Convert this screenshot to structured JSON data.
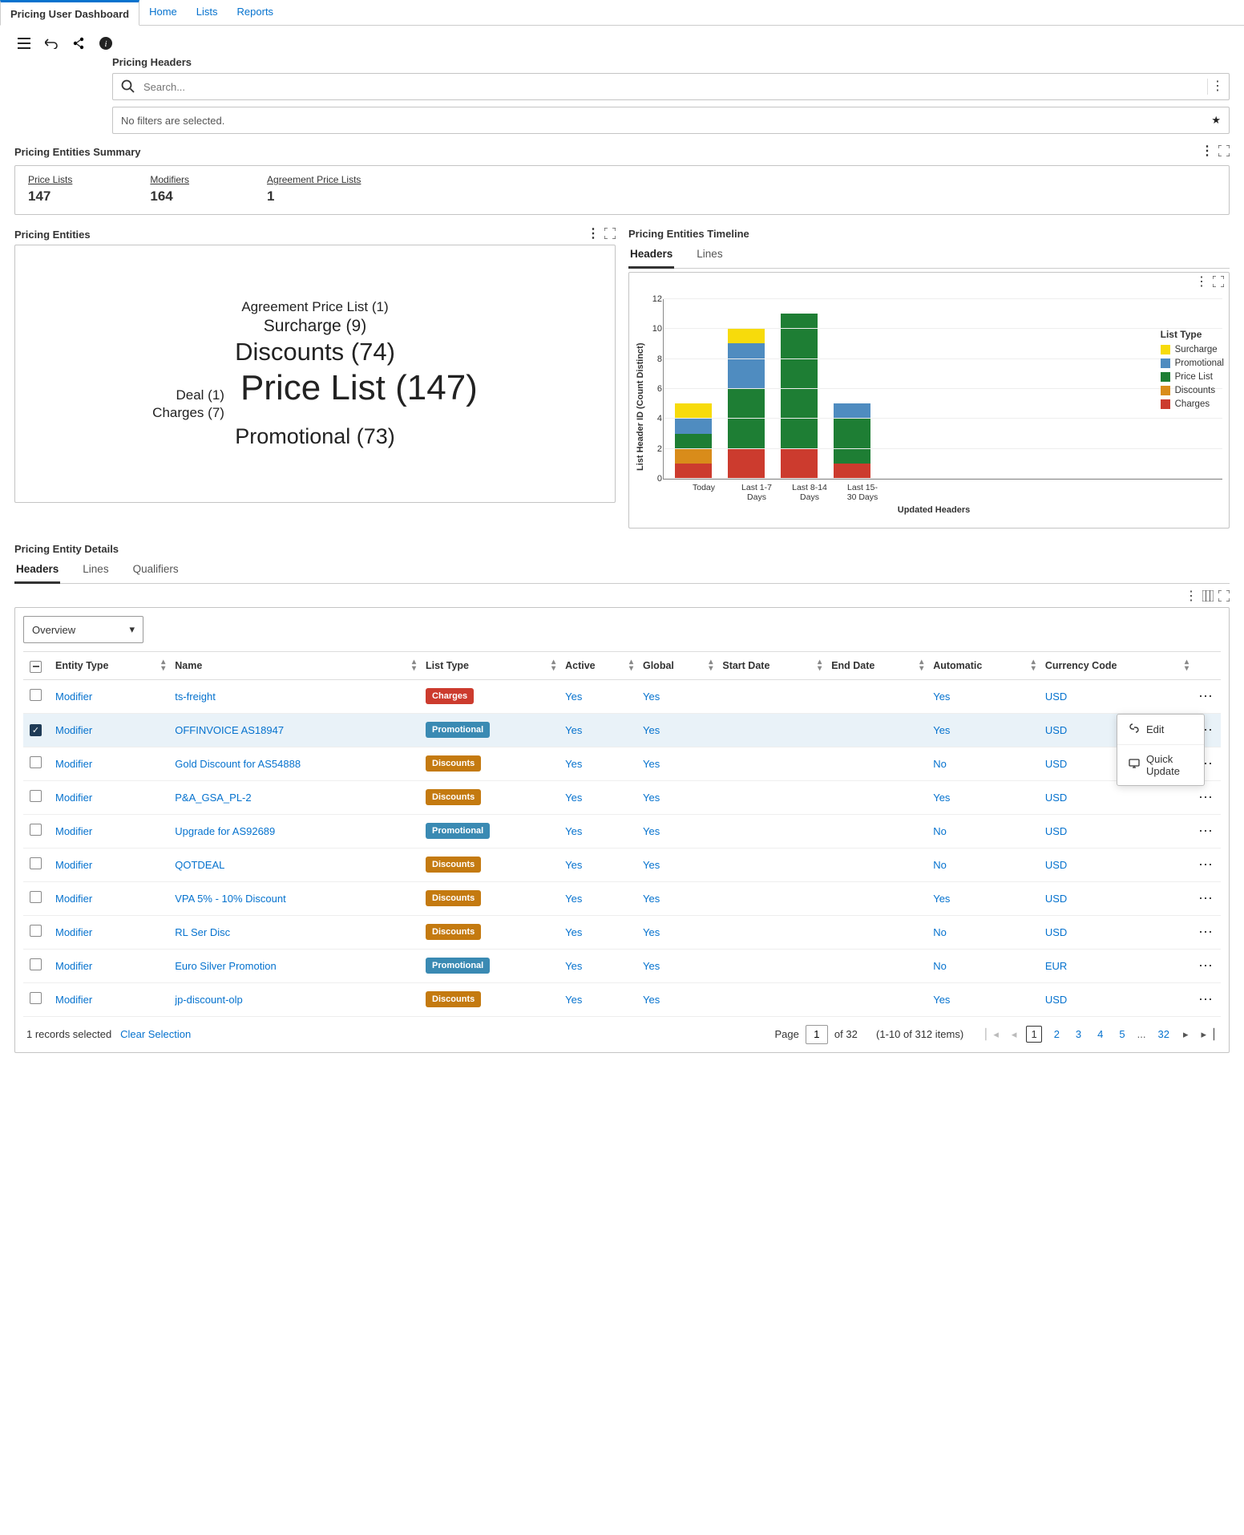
{
  "nav": {
    "tabs": [
      {
        "label": "Pricing User Dashboard",
        "active": true
      },
      {
        "label": "Home"
      },
      {
        "label": "Lists"
      },
      {
        "label": "Reports"
      }
    ]
  },
  "search": {
    "label": "Pricing Headers",
    "placeholder": "Search...",
    "filter_status": "No filters are selected."
  },
  "summary": {
    "title": "Pricing Entities Summary",
    "items": [
      {
        "label": "Price Lists",
        "value": "147"
      },
      {
        "label": "Modifiers",
        "value": "164"
      },
      {
        "label": "Agreement Price Lists",
        "value": "1"
      }
    ]
  },
  "entities_panel": {
    "title": "Pricing Entities",
    "cloud": {
      "agreement": "Agreement Price List (1)",
      "surcharge": "Surcharge (9)",
      "discounts": "Discounts (74)",
      "deal": "Deal (1)",
      "pricelist": "Price List (147)",
      "charges": "Charges (7)",
      "promotional": "Promotional (73)"
    }
  },
  "timeline_panel": {
    "title": "Pricing Entities Timeline",
    "tabs": [
      {
        "label": "Headers",
        "active": true
      },
      {
        "label": "Lines"
      }
    ]
  },
  "chart_data": {
    "type": "bar",
    "stacked": true,
    "title": "",
    "xlabel": "Updated Headers",
    "ylabel": "List Header ID (Count Distinct)",
    "ylim": [
      0,
      12
    ],
    "categories": [
      "Today",
      "Last 1-7 Days",
      "Last 8-14 Days",
      "Last 15-30 Days"
    ],
    "legend_title": "List Type",
    "legend_position": "right",
    "colors": {
      "Surcharge": "#f7db0b",
      "Promotional": "#4f8cc0",
      "Price List": "#1e7e34",
      "Discounts": "#d98c1a",
      "Charges": "#cc3b2e"
    },
    "series": [
      {
        "name": "Surcharge",
        "values": [
          1,
          1,
          0,
          0
        ]
      },
      {
        "name": "Promotional",
        "values": [
          1,
          3,
          0,
          1
        ]
      },
      {
        "name": "Price List",
        "values": [
          1,
          4,
          9,
          3
        ]
      },
      {
        "name": "Discounts",
        "values": [
          1,
          0,
          0,
          0
        ]
      },
      {
        "name": "Charges",
        "values": [
          1,
          2,
          2,
          1
        ]
      }
    ]
  },
  "details": {
    "title": "Pricing Entity Details",
    "tabs": [
      {
        "label": "Headers",
        "active": true
      },
      {
        "label": "Lines"
      },
      {
        "label": "Qualifiers"
      }
    ],
    "view_select": "Overview",
    "columns": [
      "Entity Type",
      "Name",
      "List Type",
      "Active",
      "Global",
      "Start Date",
      "End Date",
      "Automatic",
      "Currency Code"
    ],
    "rows": [
      {
        "sel": false,
        "entity": "Modifier",
        "name": "ts-freight",
        "list": "Charges",
        "active": "Yes",
        "global": "Yes",
        "start": "",
        "end": "",
        "auto": "Yes",
        "ccy": "USD"
      },
      {
        "sel": true,
        "entity": "Modifier",
        "name": "OFFINVOICE AS18947",
        "list": "Promotional",
        "active": "Yes",
        "global": "Yes",
        "start": "",
        "end": "",
        "auto": "Yes",
        "ccy": "USD",
        "menu": true
      },
      {
        "sel": false,
        "entity": "Modifier",
        "name": "Gold Discount for AS54888",
        "list": "Discounts",
        "active": "Yes",
        "global": "Yes",
        "start": "",
        "end": "",
        "auto": "No",
        "ccy": "USD"
      },
      {
        "sel": false,
        "entity": "Modifier",
        "name": "P&A_GSA_PL-2",
        "list": "Discounts",
        "active": "Yes",
        "global": "Yes",
        "start": "",
        "end": "",
        "auto": "Yes",
        "ccy": "USD"
      },
      {
        "sel": false,
        "entity": "Modifier",
        "name": "Upgrade for AS92689",
        "list": "Promotional",
        "active": "Yes",
        "global": "Yes",
        "start": "",
        "end": "",
        "auto": "No",
        "ccy": "USD"
      },
      {
        "sel": false,
        "entity": "Modifier",
        "name": "QOTDEAL",
        "list": "Discounts",
        "active": "Yes",
        "global": "Yes",
        "start": "",
        "end": "",
        "auto": "No",
        "ccy": "USD"
      },
      {
        "sel": false,
        "entity": "Modifier",
        "name": "VPA 5% - 10% Discount",
        "list": "Discounts",
        "active": "Yes",
        "global": "Yes",
        "start": "",
        "end": "",
        "auto": "Yes",
        "ccy": "USD"
      },
      {
        "sel": false,
        "entity": "Modifier",
        "name": "RL Ser Disc",
        "list": "Discounts",
        "active": "Yes",
        "global": "Yes",
        "start": "",
        "end": "",
        "auto": "No",
        "ccy": "USD"
      },
      {
        "sel": false,
        "entity": "Modifier",
        "name": "Euro Silver Promotion",
        "list": "Promotional",
        "active": "Yes",
        "global": "Yes",
        "start": "",
        "end": "",
        "auto": "No",
        "ccy": "EUR"
      },
      {
        "sel": false,
        "entity": "Modifier",
        "name": "jp-discount-olp",
        "list": "Discounts",
        "active": "Yes",
        "global": "Yes",
        "start": "",
        "end": "",
        "auto": "Yes",
        "ccy": "USD"
      }
    ],
    "selection_status": "1 records selected",
    "clear_selection": "Clear Selection",
    "ctx_menu": {
      "edit": "Edit",
      "quick": "Quick Update"
    }
  },
  "pager": {
    "page_label": "Page",
    "current": "1",
    "of_label": "of 32",
    "range": "(1-10 of 312 items)",
    "pages": [
      "1",
      "2",
      "3",
      "4",
      "5",
      "...",
      "32"
    ]
  }
}
